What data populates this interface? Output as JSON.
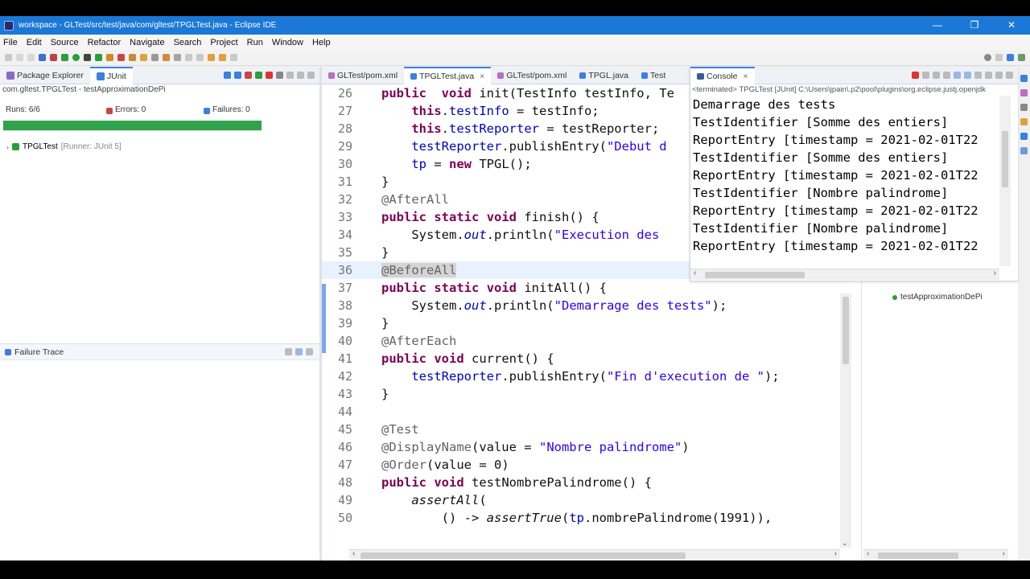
{
  "window": {
    "title": "workspace - GLTest/src/test/java/com/gltest/TPGLTest.java - Eclipse IDE",
    "minimize": "—",
    "maximize": "❐",
    "close": "✕"
  },
  "menu": [
    "File",
    "Edit",
    "Source",
    "Refactor",
    "Navigate",
    "Search",
    "Project",
    "Run",
    "Window",
    "Help"
  ],
  "left_tabs": {
    "package_explorer": "Package Explorer",
    "junit": "JUnit"
  },
  "junit": {
    "breadcrumb": "com.gltest.TPGLTest - testApproximationDePi",
    "runs": "Runs: 6/6",
    "errors": "Errors: 0",
    "failures": "Failures: 0",
    "progress": 1.0,
    "tree_item": "TPGLTest",
    "tree_item_meta": "[Runner: JUnit 5]",
    "failure_trace": "Failure Trace"
  },
  "editor_tabs": [
    "GLTest/pom.xml",
    "TPGLTest.java",
    "GLTest/pom.xml",
    "TPGL.java",
    "Test"
  ],
  "console": {
    "tab_label": "Console",
    "header": "<terminated> TPGLTest [JUnit] C:\\Users\\jpain\\.p2\\pool\\plugins\\org.eclipse.justj.openjdk",
    "lines": [
      "Demarrage des tests",
      "TestIdentifier [Somme des entiers]",
      "ReportEntry [timestamp = 2021-02-01T22",
      "TestIdentifier [Somme des entiers]",
      "ReportEntry [timestamp = 2021-02-01T22",
      "TestIdentifier [Nombre palindrome]",
      "ReportEntry [timestamp = 2021-02-01T22",
      "TestIdentifier [Nombre palindrome]",
      "ReportEntry [timestamp = 2021-02-01T22"
    ]
  },
  "outline": {
    "item": "testApproximationDePi"
  },
  "code": {
    "lines": [
      {
        "n": "26",
        "segs": [
          [
            "kw",
            "public"
          ],
          [
            "",
            "  "
          ],
          [
            "kw",
            "void"
          ],
          [
            "",
            " init(TestInfo "
          ],
          [
            "",
            ""
          ],
          [
            "",
            "testInfo, Te"
          ]
        ]
      },
      {
        "n": "27",
        "segs": [
          [
            "",
            "    "
          ],
          [
            "kw",
            "this"
          ],
          [
            "",
            "."
          ],
          [
            "fld",
            "testInfo"
          ],
          [
            "",
            " = testInfo;"
          ]
        ]
      },
      {
        "n": "28",
        "segs": [
          [
            "",
            "    "
          ],
          [
            "kw",
            "this"
          ],
          [
            "",
            "."
          ],
          [
            "fld",
            "testReporter"
          ],
          [
            "",
            " = testReporter;"
          ]
        ]
      },
      {
        "n": "29",
        "segs": [
          [
            "",
            "    "
          ],
          [
            "fld",
            "testReporter"
          ],
          [
            "",
            ".publishEntry("
          ],
          [
            "str",
            "\"Debut d"
          ]
        ]
      },
      {
        "n": "30",
        "segs": [
          [
            "",
            "    "
          ],
          [
            "fld",
            "tp"
          ],
          [
            "",
            " = "
          ],
          [
            "kw",
            "new"
          ],
          [
            "",
            " TPGL();"
          ]
        ]
      },
      {
        "n": "31",
        "segs": [
          [
            "",
            "}"
          ]
        ]
      },
      {
        "n": "32",
        "segs": [
          [
            "ann",
            "@AfterAll"
          ]
        ]
      },
      {
        "n": "33",
        "segs": [
          [
            "kw",
            "public"
          ],
          [
            "",
            " "
          ],
          [
            "kw",
            "static"
          ],
          [
            "",
            " "
          ],
          [
            "kw",
            "void"
          ],
          [
            "",
            " finish() {"
          ]
        ]
      },
      {
        "n": "34",
        "segs": [
          [
            "",
            "    System."
          ],
          [
            "fld it",
            "out"
          ],
          [
            "",
            ".println("
          ],
          [
            "str",
            "\"Execution des "
          ]
        ]
      },
      {
        "n": "35",
        "segs": [
          [
            "",
            "}"
          ]
        ]
      },
      {
        "n": "36",
        "segs": [
          [
            "ann hlword",
            "@BeforeAll"
          ]
        ]
      },
      {
        "n": "37",
        "segs": [
          [
            "kw",
            "public"
          ],
          [
            "",
            " "
          ],
          [
            "kw",
            "static"
          ],
          [
            "",
            " "
          ],
          [
            "kw",
            "void"
          ],
          [
            "",
            " initAll() {"
          ]
        ]
      },
      {
        "n": "38",
        "segs": [
          [
            "",
            "    System."
          ],
          [
            "fld it",
            "out"
          ],
          [
            "",
            ".println("
          ],
          [
            "str",
            "\"Demarrage des tests\""
          ],
          [
            "",
            ");"
          ]
        ]
      },
      {
        "n": "39",
        "segs": [
          [
            "",
            "}"
          ]
        ]
      },
      {
        "n": "40",
        "segs": [
          [
            "ann",
            "@AfterEach"
          ]
        ]
      },
      {
        "n": "41",
        "segs": [
          [
            "kw",
            "public"
          ],
          [
            "",
            " "
          ],
          [
            "kw",
            "void"
          ],
          [
            "",
            " current() {"
          ]
        ]
      },
      {
        "n": "42",
        "segs": [
          [
            "",
            "    "
          ],
          [
            "fld",
            "testReporter"
          ],
          [
            "",
            ".publishEntry("
          ],
          [
            "str",
            "\"Fin d'execution de \""
          ],
          [
            "",
            ");"
          ]
        ]
      },
      {
        "n": "43",
        "segs": [
          [
            "",
            "}"
          ]
        ]
      },
      {
        "n": "44",
        "segs": [
          [
            "",
            ""
          ]
        ]
      },
      {
        "n": "45",
        "segs": [
          [
            "ann",
            "@Test"
          ]
        ]
      },
      {
        "n": "46",
        "segs": [
          [
            "ann",
            "@DisplayName"
          ],
          [
            "",
            "(value = "
          ],
          [
            "str",
            "\"Nombre palindrome\""
          ],
          [
            "",
            ")"
          ]
        ]
      },
      {
        "n": "47",
        "segs": [
          [
            "ann",
            "@Order"
          ],
          [
            "",
            "(value = 0)"
          ]
        ]
      },
      {
        "n": "48",
        "segs": [
          [
            "kw",
            "public"
          ],
          [
            "",
            " "
          ],
          [
            "kw",
            "void"
          ],
          [
            "",
            " testNombrePalindrome() {"
          ]
        ]
      },
      {
        "n": "49",
        "segs": [
          [
            "",
            "    "
          ],
          [
            "it",
            "assertAll"
          ],
          [
            "",
            "("
          ]
        ]
      },
      {
        "n": "50",
        "segs": [
          [
            "",
            "        () -> "
          ],
          [
            "it",
            "assertTrue"
          ],
          [
            "",
            "("
          ],
          [
            "fld",
            "tp"
          ],
          [
            "",
            ".nombrePalindrome(1991)),"
          ]
        ]
      }
    ]
  },
  "colors": {
    "titlebar": "#1b78d6",
    "progress": "#31a24c",
    "keyword": "#7f0055",
    "field": "#0000c0",
    "string": "#2a00ff",
    "annotation": "#646464"
  }
}
